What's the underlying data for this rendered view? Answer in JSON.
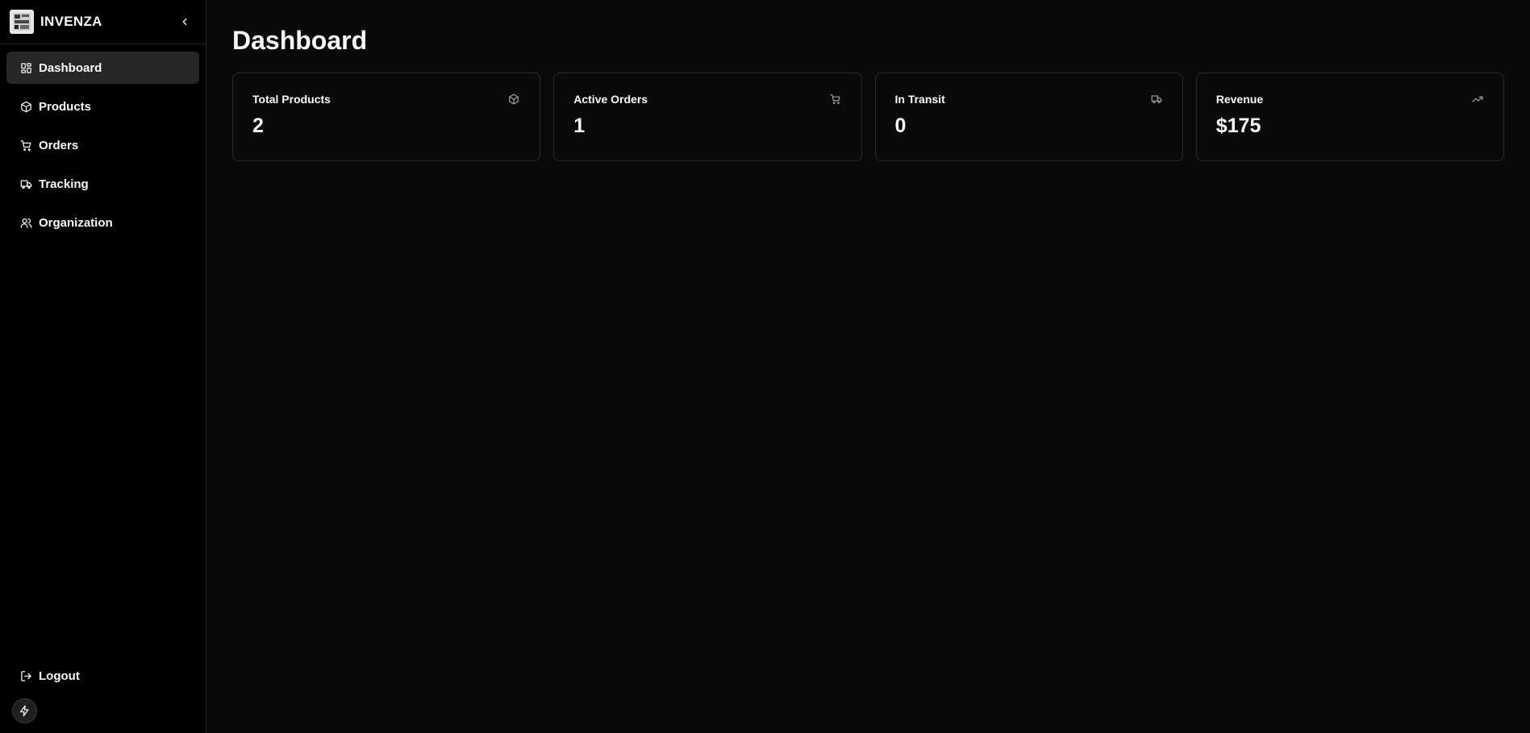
{
  "brand": {
    "name": "INVENZA"
  },
  "sidebar": {
    "items": [
      {
        "label": "Dashboard",
        "icon": "layout-dashboard-icon",
        "active": true
      },
      {
        "label": "Products",
        "icon": "package-icon",
        "active": false
      },
      {
        "label": "Orders",
        "icon": "shopping-cart-icon",
        "active": false
      },
      {
        "label": "Tracking",
        "icon": "truck-icon",
        "active": false
      },
      {
        "label": "Organization",
        "icon": "users-icon",
        "active": false
      }
    ],
    "logout_label": "Logout"
  },
  "main": {
    "title": "Dashboard",
    "cards": [
      {
        "title": "Total Products",
        "value": "2",
        "icon": "package-icon"
      },
      {
        "title": "Active Orders",
        "value": "1",
        "icon": "shopping-cart-icon"
      },
      {
        "title": "In Transit",
        "value": "0",
        "icon": "truck-icon"
      },
      {
        "title": "Revenue",
        "value": "$175",
        "icon": "trending-up-icon"
      }
    ]
  },
  "colors": {
    "background": "#0a0a0a",
    "sidebar": "#000000",
    "active_item": "#262626",
    "border": "#2a2a2a",
    "text": "#fafafa"
  }
}
